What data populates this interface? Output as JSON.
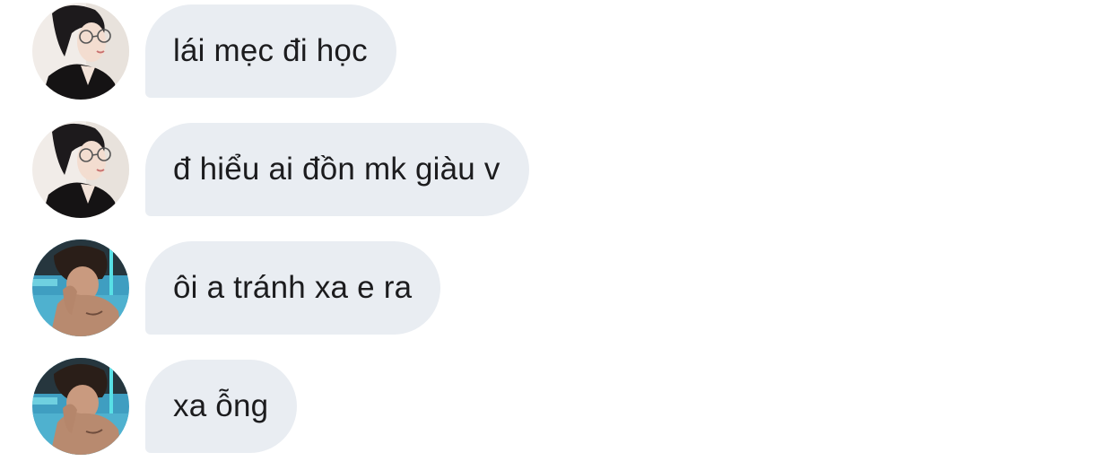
{
  "messages": [
    {
      "sender": "user-a",
      "text": "lái mẹc đi học"
    },
    {
      "sender": "user-a",
      "text": "đ hiểu ai đồn mk giàu v"
    },
    {
      "sender": "user-b",
      "text": "ôi a tránh xa e ra"
    },
    {
      "sender": "user-b",
      "text": "xa ỗng"
    }
  ],
  "colors": {
    "bubble_bg": "#e9edf2",
    "text": "#1c1c1e",
    "background": "#ffffff"
  }
}
